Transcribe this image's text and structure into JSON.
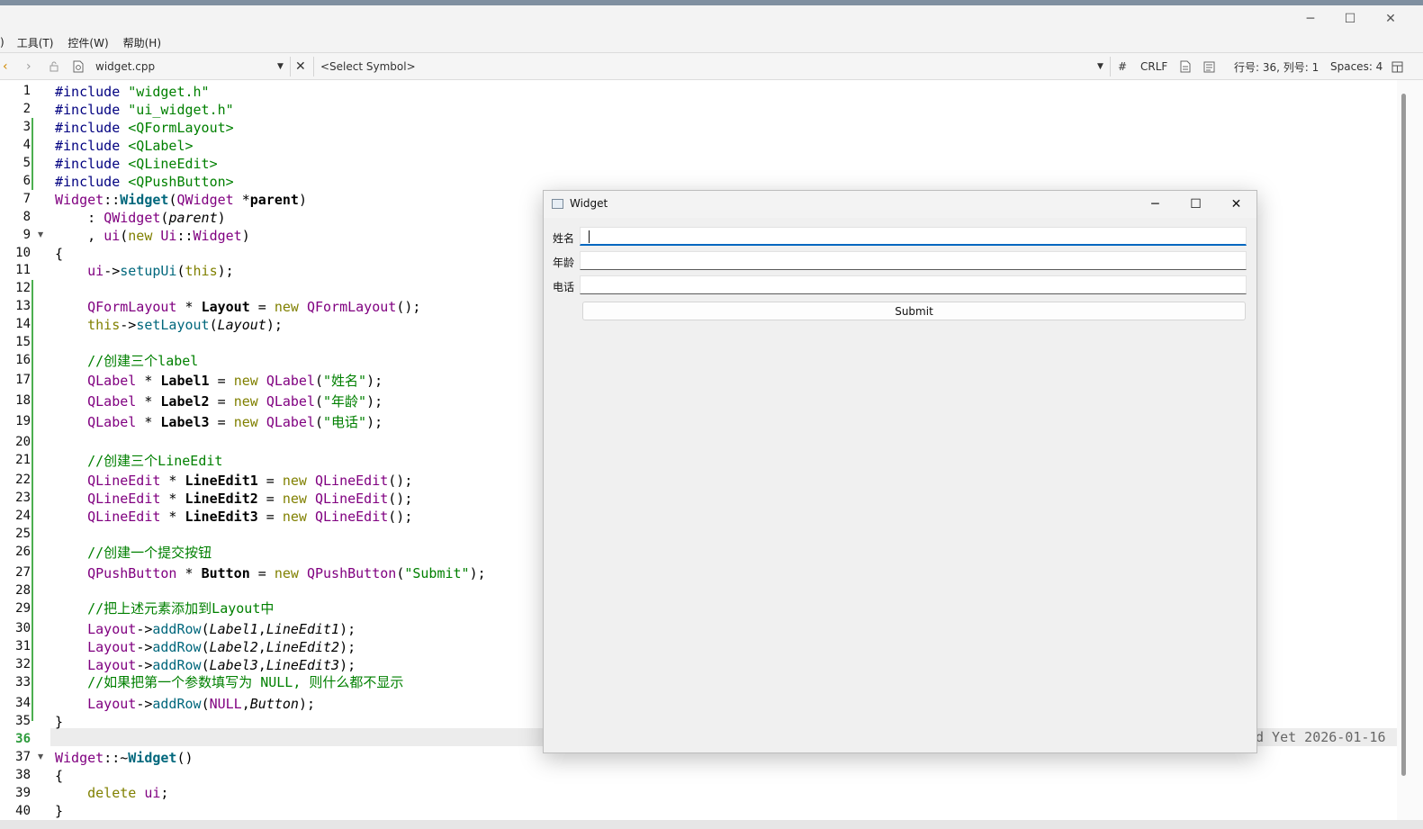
{
  "menu": [
    "工具(T)",
    "控件(W)",
    "帮助(H)"
  ],
  "menu_lead": ")",
  "toolbar": {
    "file_name": "widget.cpp",
    "symbol": "<Select Symbol>",
    "hash": "#",
    "line_ending": "CRLF",
    "position": "行号: 36, 列号: 1",
    "spaces": "Spaces: 4"
  },
  "editor": {
    "line_numbers": [
      "1",
      "2",
      "3",
      "4",
      "5",
      "6",
      "7",
      "8",
      "9",
      "10",
      "11",
      "12",
      "13",
      "14",
      "15",
      "16",
      "17",
      "18",
      "19",
      "20",
      "21",
      "22",
      "23",
      "24",
      "25",
      "26",
      "27",
      "28",
      "29",
      "30",
      "31",
      "32",
      "33",
      "34",
      "35",
      "36",
      "37",
      "38",
      "39",
      "40"
    ],
    "blame": "d Yet 2026-01-16"
  },
  "dialog": {
    "title": "Widget",
    "labels": [
      "姓名",
      "年龄",
      "电话"
    ],
    "submit": "Submit"
  }
}
